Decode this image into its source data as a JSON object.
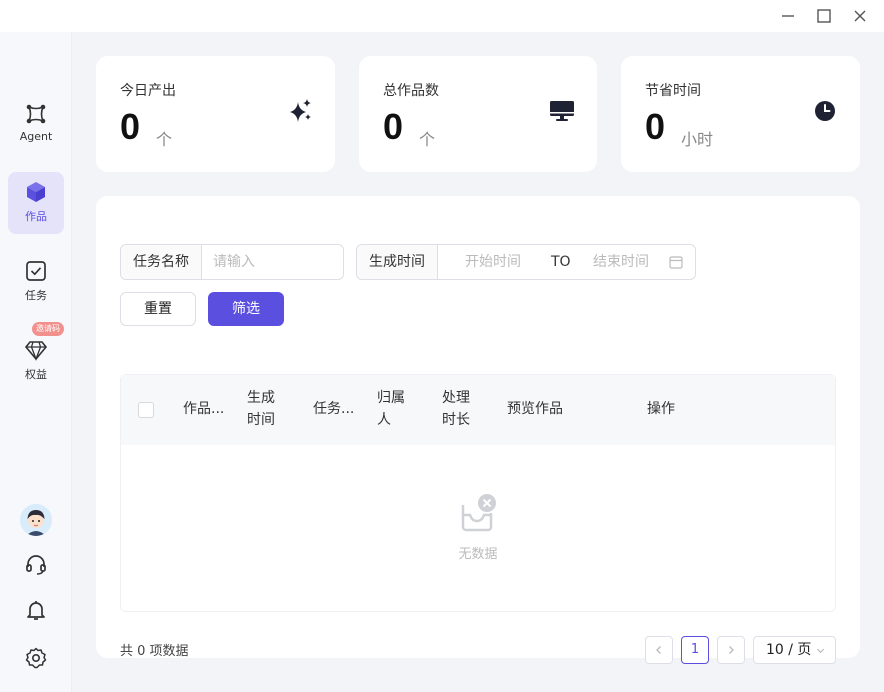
{
  "window": {
    "controls": [
      "minimize-icon",
      "maximize-icon",
      "close-icon"
    ]
  },
  "sidebar": {
    "items": [
      {
        "label": "Agent",
        "icon": "agent-icon",
        "active": false
      },
      {
        "label": "作品",
        "icon": "cube-icon",
        "active": true
      },
      {
        "label": "任务",
        "icon": "task-checkbox-icon",
        "active": false
      },
      {
        "label": "权益",
        "icon": "diamond-icon",
        "active": false,
        "badge": "邀请码"
      }
    ],
    "bottom": [
      "avatar",
      "headset-icon",
      "bell-icon",
      "gear-icon"
    ]
  },
  "stats": [
    {
      "label": "今日产出",
      "value": "0",
      "unit": "个",
      "icon": "sparkles-icon"
    },
    {
      "label": "总作品数",
      "value": "0",
      "unit": "个",
      "icon": "monitor-icon"
    },
    {
      "label": "节省时间",
      "value": "0",
      "unit": "小时",
      "icon": "clock-icon"
    }
  ],
  "filters": {
    "task_name_label": "任务名称",
    "task_name_placeholder": "请输入",
    "time_label": "生成时间",
    "start_placeholder": "开始时间",
    "to_label": "TO",
    "end_placeholder": "结束时间",
    "reset_label": "重置",
    "filter_label": "筛选"
  },
  "table": {
    "columns": [
      "作品...",
      "生成\n时间",
      "任务...",
      "归属\n人",
      "处理\n时长",
      "预览作品",
      "操作"
    ],
    "empty_text": "无数据"
  },
  "pagination": {
    "total_text": "共 0 项数据",
    "current_page": "1",
    "page_size": "10 / 页"
  },
  "colors": {
    "accent": "#5b4fe0",
    "background": "#f3f4f8",
    "badge": "#f2908e"
  }
}
